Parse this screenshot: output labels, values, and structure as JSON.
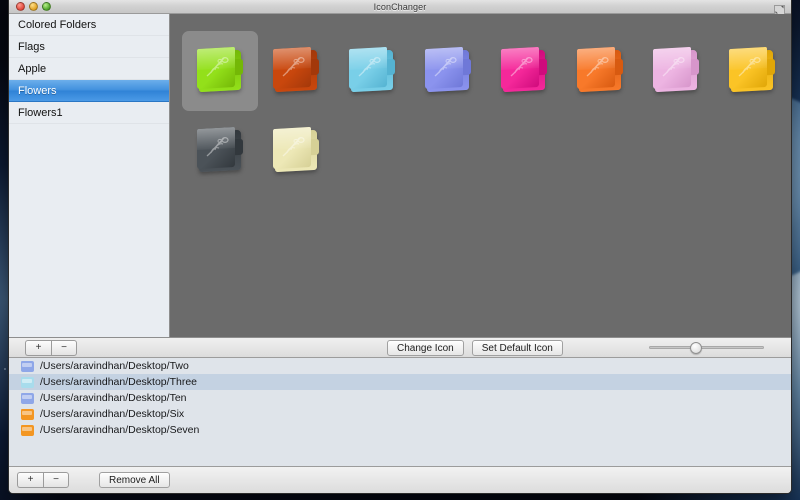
{
  "window": {
    "title": "IconChanger",
    "traffic_lights": [
      "close-button",
      "minimize-button",
      "zoom-button"
    ],
    "fullscreen_icon": "fullscreen-arrows-icon"
  },
  "sidebar": {
    "items": [
      {
        "label": "Colored Folders",
        "selected": false
      },
      {
        "label": "Flags",
        "selected": false
      },
      {
        "label": "Apple",
        "selected": false
      },
      {
        "label": "Flowers",
        "selected": true
      },
      {
        "label": "Flowers1",
        "selected": false
      }
    ]
  },
  "icon_grid": {
    "background": "#6b6b6b",
    "icons": [
      {
        "name": "folder-green",
        "color": "#93e01a",
        "shade": "#74b806",
        "selected": true
      },
      {
        "name": "folder-rust",
        "color": "#c9470d",
        "shade": "#a3380a",
        "selected": false
      },
      {
        "name": "folder-skyblue",
        "color": "#79cfe8",
        "shade": "#55b3d2",
        "selected": false
      },
      {
        "name": "folder-periwinkle",
        "color": "#8b93ee",
        "shade": "#6f78d8",
        "selected": false
      },
      {
        "name": "folder-magenta",
        "color": "#f5289a",
        "shade": "#cf0b7c",
        "selected": false
      },
      {
        "name": "folder-orange",
        "color": "#f8792a",
        "shade": "#d85a10",
        "selected": false
      },
      {
        "name": "folder-pink",
        "color": "#edb4e2",
        "shade": "#d796cb",
        "selected": false
      },
      {
        "name": "folder-yellow",
        "color": "#fbc426",
        "shade": "#e0a607",
        "selected": false
      },
      {
        "name": "folder-charcoal",
        "color": "#4b5258",
        "shade": "#32383d",
        "selected": false
      },
      {
        "name": "folder-cream",
        "color": "#ede8b6",
        "shade": "#d6d096",
        "selected": false
      }
    ]
  },
  "toolbar": {
    "add_label": "+",
    "remove_label": "−",
    "change_icon_label": "Change Icon",
    "set_default_icon_label": "Set Default Icon",
    "slider_value": 36
  },
  "file_list": {
    "rows": [
      {
        "path": "/Users/aravindhan/Desktop/Two",
        "icon_color": "#8fa7e8",
        "selected": false
      },
      {
        "path": "/Users/aravindhan/Desktop/Three",
        "icon_color": "#a8dcec",
        "selected": true
      },
      {
        "path": "/Users/aravindhan/Desktop/Ten",
        "icon_color": "#8fa7e8",
        "selected": false
      },
      {
        "path": "/Users/aravindhan/Desktop/Six",
        "icon_color": "#f39622",
        "selected": false
      },
      {
        "path": "/Users/aravindhan/Desktop/Seven",
        "icon_color": "#f39622",
        "selected": false
      }
    ]
  },
  "bottom_bar": {
    "add_label": "+",
    "remove_label": "−",
    "remove_all_label": "Remove All"
  }
}
